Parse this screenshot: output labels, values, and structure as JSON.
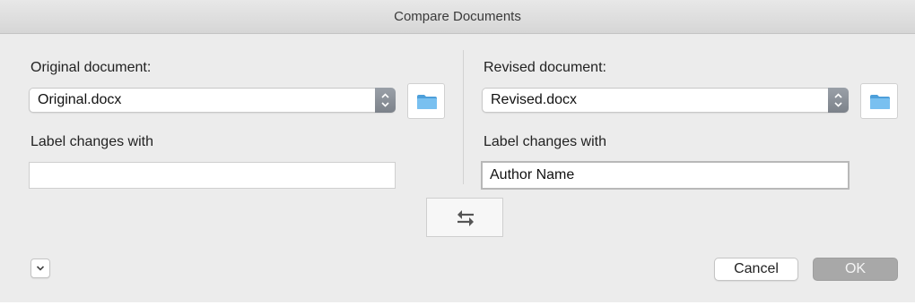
{
  "window": {
    "title": "Compare Documents"
  },
  "original": {
    "label": "Original document:",
    "selected_file": "Original.docx",
    "label_changes_title": "Label changes with",
    "label_changes_value": ""
  },
  "revised": {
    "label": "Revised document:",
    "selected_file": "Revised.docx",
    "label_changes_title": "Label changes with",
    "label_changes_value": "Author Name"
  },
  "buttons": {
    "cancel_label": "Cancel",
    "ok_label": "OK"
  },
  "icons": {
    "folder": "folder-icon",
    "swap": "swap-arrows-icon",
    "stepper": "up-down-chevron-icon",
    "disclosure": "chevron-down-icon"
  },
  "colors": {
    "folder_blue": "#5aaee8",
    "ok_disabled_bg": "#a8a8a8",
    "stepper_gray": "#8a9098"
  }
}
